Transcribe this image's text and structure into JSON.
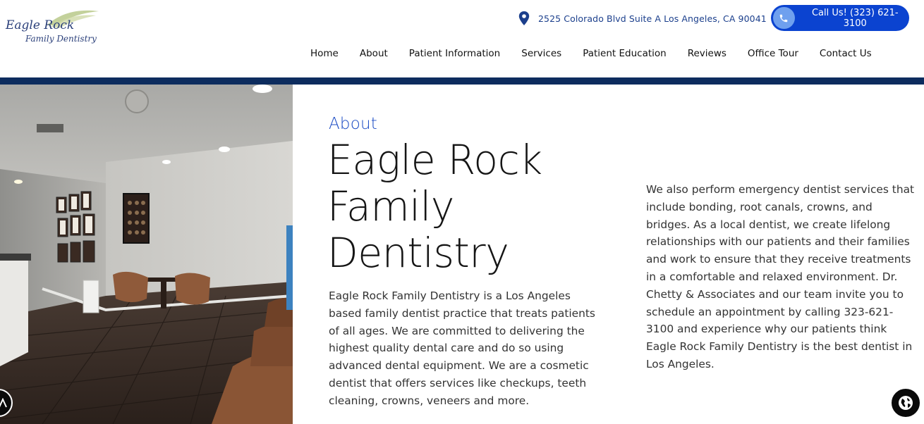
{
  "logo": {
    "line1": "Eagle Rock",
    "line2": "Family Dentistry"
  },
  "header": {
    "address": "2525 Colorado Blvd Suite A Los Angeles, CA 90041",
    "call_label": "Call Us! (323) 621-3100",
    "icons": {
      "address": "map-pin-icon",
      "call": "phone-icon"
    },
    "colors": {
      "call_button": "#0b43d0",
      "band": "#0d2c5e",
      "accent_text": "#1b3f8c"
    }
  },
  "nav": {
    "items": [
      "Home",
      "About",
      "Patient Information",
      "Services",
      "Patient Education",
      "Reviews",
      "Office Tour",
      "Contact Us"
    ]
  },
  "main": {
    "eyebrow": "About",
    "title_lines": [
      "Eagle Rock",
      "Family",
      "Dentistry"
    ],
    "body_left": "Eagle Rock Family Dentistry is a Los Angeles based family dentist practice that treats patients of all ages. We are committed to delivering the highest quality dental care and do so using advanced dental equipment. We are a cosmetic dentist that offers services like checkups, teeth cleaning, crowns, veneers and more.",
    "body_right": "We also perform emergency dentist services that include bonding, root canals, crowns, and bridges. As a local dentist, we create lifelong relationships with our patients and their families and work to ensure that they receive treatments in a comfortable and relaxed environment. Dr. Chetty & Associates and our team invite you to schedule an appointment by calling 323-621-3100 and experience why our patients think Eagle Rock Family Dentistry is the best dentist in Los Angeles."
  },
  "floating": {
    "left_icon": "accessibility-icon",
    "right_icon": "globe-icon"
  }
}
